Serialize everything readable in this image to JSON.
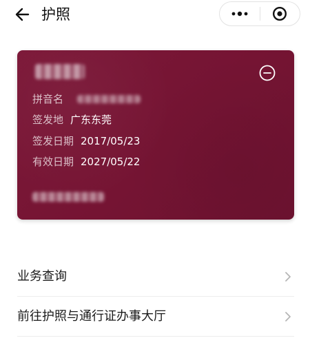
{
  "header": {
    "title": "护照",
    "back_icon": "arrow-left-icon",
    "capsule": {
      "more_icon": "more-dots-icon",
      "close_icon": "target-close-icon"
    }
  },
  "card": {
    "color": "#761535",
    "collapse_icon": "minus-circle-icon",
    "fields": [
      {
        "label": "拼音名",
        "value": ""
      },
      {
        "label": "签发地",
        "value": "广东东莞"
      },
      {
        "label": "签发日期",
        "value": "2017/05/23"
      },
      {
        "label": "有效日期",
        "value": "2027/05/22"
      }
    ]
  },
  "list": {
    "items": [
      {
        "label": "业务查询"
      },
      {
        "label": "前往护照与通行证办事大厅"
      }
    ]
  }
}
